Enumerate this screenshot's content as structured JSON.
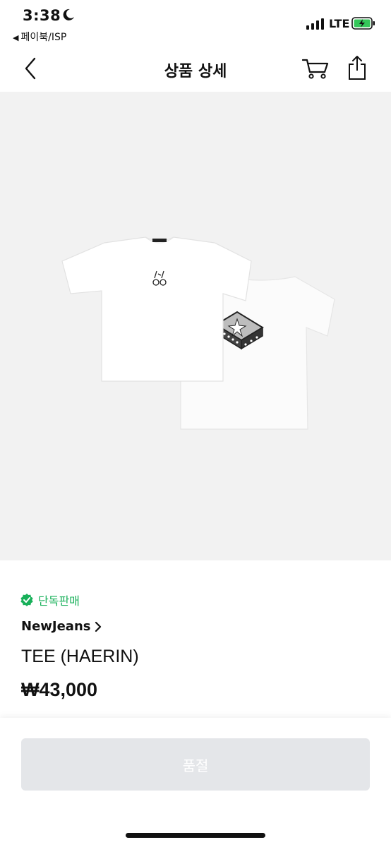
{
  "status_bar": {
    "time": "3:38",
    "back_app": "페이북/ISP",
    "network": "LTE",
    "icons": [
      "moon-icon",
      "signal-icon",
      "battery-charging-icon"
    ]
  },
  "header": {
    "title": "상품 상세",
    "icons": [
      "back-chevron-icon",
      "cart-icon",
      "share-icon"
    ]
  },
  "product": {
    "badge": "단독판매",
    "brand": "NewJeans",
    "name": "TEE (HAERIN)",
    "price": "₩43,000"
  },
  "bottom": {
    "button_label": "품절"
  },
  "colors": {
    "accent_green": "#18b05a",
    "image_bg": "#f2f2f2",
    "button_disabled_bg": "#e4e6e9",
    "battery_green": "#34c759"
  }
}
